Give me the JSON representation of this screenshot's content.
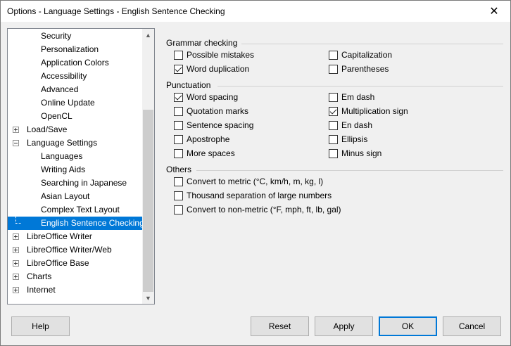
{
  "window": {
    "title": "Options - Language Settings - English Sentence Checking",
    "close_glyph": "✕"
  },
  "tree": {
    "items": [
      {
        "label": "Security",
        "level": 2
      },
      {
        "label": "Personalization",
        "level": 2
      },
      {
        "label": "Application Colors",
        "level": 2
      },
      {
        "label": "Accessibility",
        "level": 2
      },
      {
        "label": "Advanced",
        "level": 2
      },
      {
        "label": "Online Update",
        "level": 2
      },
      {
        "label": "OpenCL",
        "level": 2
      },
      {
        "label": "Load/Save",
        "level": 1,
        "expander": "plus"
      },
      {
        "label": "Language Settings",
        "level": 1,
        "expander": "minus"
      },
      {
        "label": "Languages",
        "level": 2
      },
      {
        "label": "Writing Aids",
        "level": 2
      },
      {
        "label": "Searching in Japanese",
        "level": 2
      },
      {
        "label": "Asian Layout",
        "level": 2
      },
      {
        "label": "Complex Text Layout",
        "level": 2
      },
      {
        "label": "English Sentence Checking",
        "level": 2,
        "selected": true
      },
      {
        "label": "LibreOffice Writer",
        "level": 1,
        "expander": "plus"
      },
      {
        "label": "LibreOffice Writer/Web",
        "level": 1,
        "expander": "plus"
      },
      {
        "label": "LibreOffice Base",
        "level": 1,
        "expander": "plus"
      },
      {
        "label": "Charts",
        "level": 1,
        "expander": "plus"
      },
      {
        "label": "Internet",
        "level": 1,
        "expander": "plus"
      }
    ],
    "scroll_up_glyph": "▲",
    "scroll_down_glyph": "▼"
  },
  "grammar": {
    "header": "Grammar checking",
    "possible_mistakes": "Possible mistakes",
    "word_duplication": "Word duplication",
    "capitalization": "Capitalization",
    "parentheses": "Parentheses"
  },
  "punctuation": {
    "header": "Punctuation",
    "word_spacing": "Word spacing",
    "quotation_marks": "Quotation marks",
    "sentence_spacing": "Sentence spacing",
    "apostrophe": "Apostrophe",
    "more_spaces": "More spaces",
    "em_dash": "Em dash",
    "multiplication_sign": "Multiplication sign",
    "en_dash": "En dash",
    "ellipsis": "Ellipsis",
    "minus_sign": "Minus sign"
  },
  "others": {
    "header": "Others",
    "convert_metric": "Convert to metric (°C, km/h, m, kg, l)",
    "thousand_sep": "Thousand separation of large numbers",
    "convert_nonmetric": "Convert to non-metric (°F, mph, ft, lb, gal)"
  },
  "checked": {
    "possible_mistakes": false,
    "word_duplication": true,
    "capitalization": false,
    "parentheses": false,
    "word_spacing": true,
    "quotation_marks": false,
    "sentence_spacing": false,
    "apostrophe": false,
    "more_spaces": false,
    "em_dash": false,
    "multiplication_sign": true,
    "en_dash": false,
    "ellipsis": false,
    "minus_sign": false,
    "convert_metric": false,
    "thousand_sep": false,
    "convert_nonmetric": false
  },
  "buttons": {
    "help": "Help",
    "reset": "Reset",
    "apply": "Apply",
    "ok": "OK",
    "cancel": "Cancel"
  }
}
